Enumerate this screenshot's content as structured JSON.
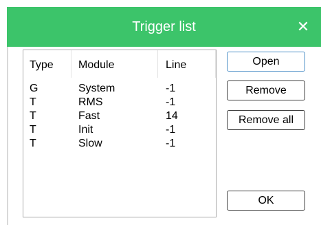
{
  "window": {
    "title": "Trigger list",
    "close_glyph": "✕"
  },
  "list": {
    "columns": [
      "Type",
      "Module",
      "Line"
    ],
    "rows": [
      {
        "type": "G",
        "module": "System",
        "line": "-1"
      },
      {
        "type": "T",
        "module": "RMS",
        "line": "-1"
      },
      {
        "type": "T",
        "module": "Fast",
        "line": "14"
      },
      {
        "type": "T",
        "module": "Init",
        "line": "-1"
      },
      {
        "type": "T",
        "module": "Slow",
        "line": "-1"
      }
    ]
  },
  "buttons": {
    "open": "Open",
    "remove": "Remove",
    "remove_all": "Remove all",
    "ok": "OK"
  },
  "colors": {
    "titlebar": "#3cc46a",
    "title_text": "#ffffff",
    "default_button_border": "#4d8fc7"
  }
}
